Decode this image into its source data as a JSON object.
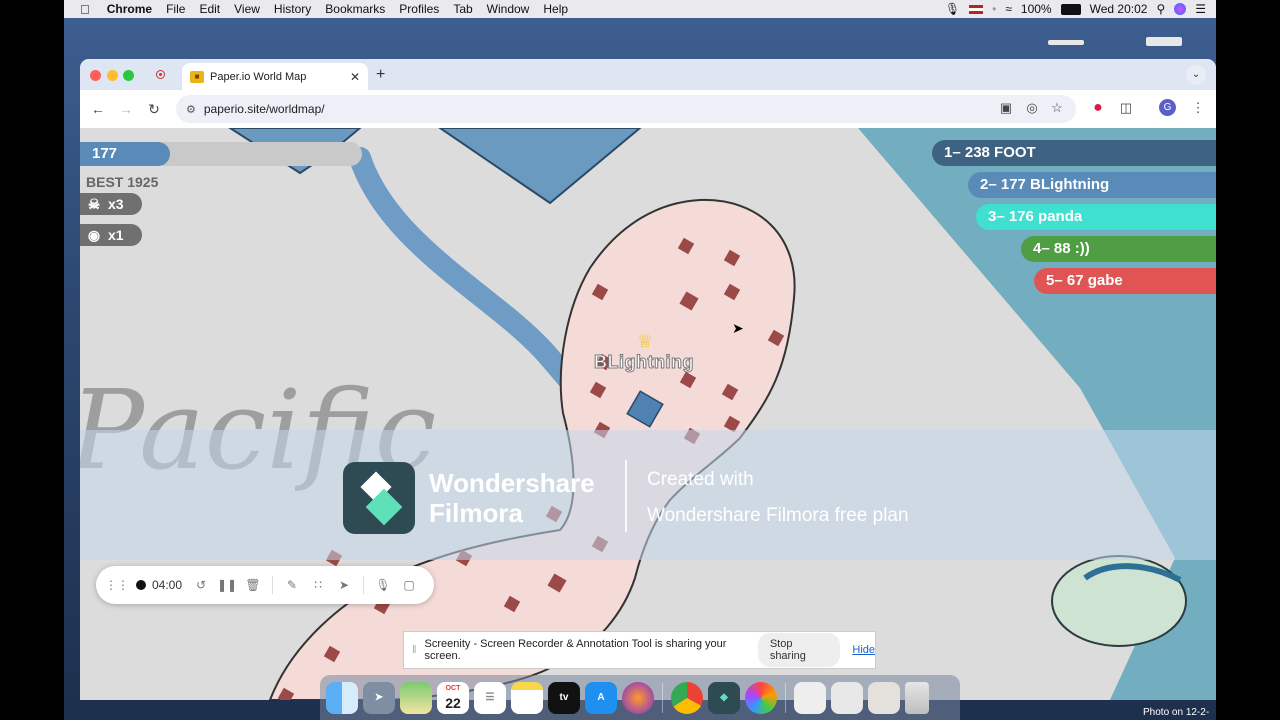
{
  "menubar": {
    "app": "Chrome",
    "items": [
      "File",
      "Edit",
      "View",
      "History",
      "Bookmarks",
      "Profiles",
      "Tab",
      "Window",
      "Help"
    ],
    "battery": "100%",
    "clock": "Wed 20:02"
  },
  "browser": {
    "tab_title": "Paper.io World Map",
    "url": "paperio.site/worldmap/",
    "profile_initial": "G"
  },
  "game": {
    "score": "177",
    "best": "BEST 1925",
    "kills": "x3",
    "captures": "x1",
    "player_name": "BLightning",
    "map_label_1": "Pacific",
    "leaderboard": [
      {
        "text": "1– 238 FOOT",
        "color": "#3e6282"
      },
      {
        "text": "2– 177 BLightning",
        "color": "#5a8ab8"
      },
      {
        "text": "3– 176 panda",
        "color": "#3fe0d0"
      },
      {
        "text": "4– 88 :))",
        "color": "#4f9e44"
      },
      {
        "text": "5– 67 gabe",
        "color": "#e05454"
      }
    ]
  },
  "watermark": {
    "brand_line1": "Wondershare",
    "brand_line2": "Filmora",
    "created_with": "Created with",
    "plan": "Wondershare Filmora free plan"
  },
  "recorder": {
    "time": "04:00"
  },
  "sharing": {
    "message": "Screenity - Screen Recorder & Annotation Tool is sharing your screen.",
    "stop_label": "Stop sharing",
    "hide_label": "Hide"
  },
  "dock": {
    "calendar_day": "22",
    "calendar_month": "OCT",
    "tv_label": "tv"
  },
  "desktop": {
    "photo_label": "Photo on 12-2-"
  }
}
